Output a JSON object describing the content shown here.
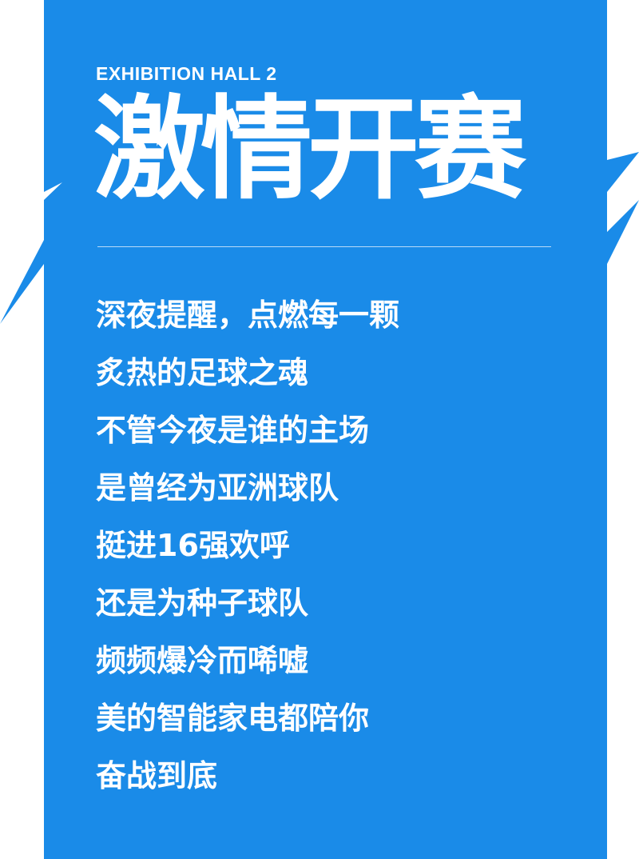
{
  "poster": {
    "hall_label": "EXHIBITION HALL 2",
    "headline": "激情开赛",
    "body_lines": [
      "深夜提醒，点燃每一颗",
      "炙热的足球之魂",
      "不管今夜是谁的主场",
      "是曾经为亚洲球队",
      "挺进16强欢呼",
      "还是为种子球队",
      "频频爆冷而唏嘘",
      "美的智能家电都陪你",
      "奋战到底"
    ]
  },
  "colors": {
    "panel_blue": "#1A8BE8",
    "text": "#FFFFFF",
    "background": "#FFFFFF"
  }
}
